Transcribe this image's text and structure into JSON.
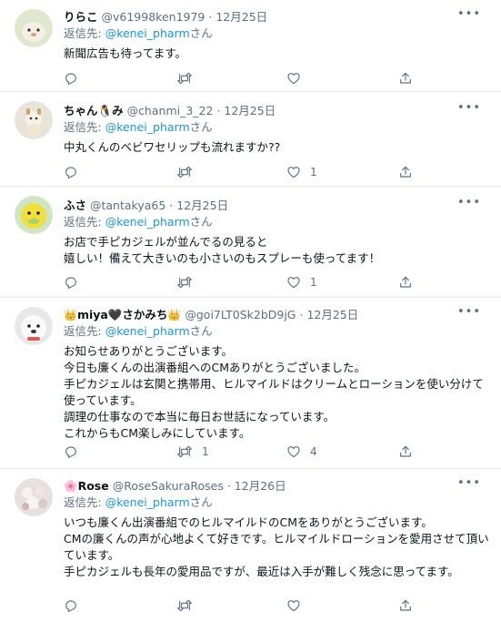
{
  "reply_prefix": "返信先: ",
  "reply_suffix": "さん",
  "more_label": "•••",
  "tweets": [
    {
      "name": "りらこ",
      "handle": "@v61998ken1979",
      "date": "12月25日",
      "reply_to": "@kenei_pharm",
      "text": "新聞広告も待ってます。",
      "replies": "",
      "retweets": "",
      "likes": ""
    },
    {
      "name": "ちゃん🐧み",
      "handle": "@chanmi_3_22",
      "date": "12月25日",
      "reply_to": "@kenei_pharm",
      "text": "中丸くんのベビワセリップも流れますか??",
      "replies": "",
      "retweets": "",
      "likes": "1"
    },
    {
      "name": "ふさ",
      "handle": "@tantakya65",
      "date": "12月25日",
      "reply_to": "@kenei_pharm",
      "text": "お店で手ピカジェルが並んでるの見ると\n嬉しい！備えて大きいのも小さいのもスプレーも使ってます！",
      "replies": "",
      "retweets": "",
      "likes": "1"
    },
    {
      "name": "miya🖤さかみち",
      "name_prefix": "👑",
      "name_suffix": "👑",
      "handle": "@goi7LT0Sk2bD9jG",
      "date": "12月25日",
      "reply_to": "@kenei_pharm",
      "text": "お知らせありがとうございます。\n今日も廉くんの出演番組へのCMありがとうございました。\n手ピカジェルは玄関と携帯用、ヒルマイルドはクリームとローションを使い分けて使っています。\n調理の仕事なので本当に毎日お世話になっています。\nこれからもCM楽しみにしています。",
      "replies": "",
      "retweets": "1",
      "likes": "4"
    },
    {
      "name": "Rose",
      "name_prefix": "🌸",
      "handle": "@RoseSakuraRoses",
      "date": "12月26日",
      "reply_to": "@kenei_pharm",
      "text": "いつも廉くん出演番組でのヒルマイルドのCMをありがとうございます。\nCMの廉くんの声が心地よくて好きです。ヒルマイルドローションを愛用させて頂いています。\n手ピカジェルも長年の愛用品ですが、最近は入手が難しく残念に思ってます。",
      "replies": "",
      "retweets": "",
      "likes": ""
    }
  ]
}
